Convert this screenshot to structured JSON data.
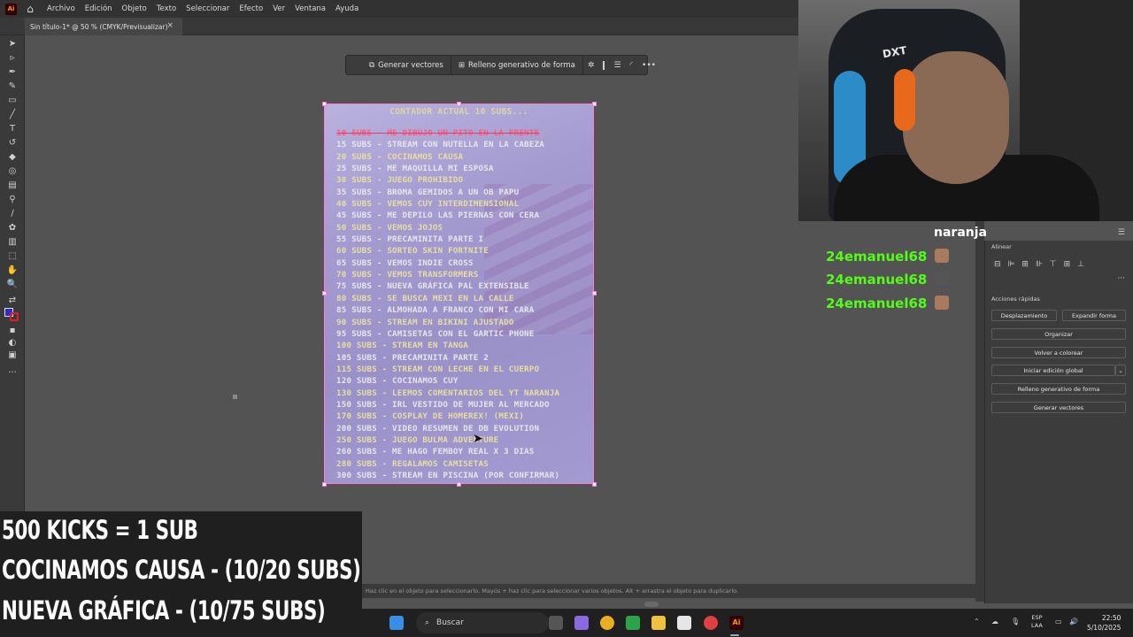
{
  "menubar": {
    "items": [
      "Archivo",
      "Edición",
      "Objeto",
      "Texto",
      "Seleccionar",
      "Efecto",
      "Ver",
      "Ventana",
      "Ayuda"
    ]
  },
  "doc_tab": {
    "label": "Sin título-1* @ 50 % (CMYK/Previsualizar)",
    "close": "×"
  },
  "context_bar": {
    "generate_vectors": "Generar vectores",
    "generative_fill": "Relleno generativo de forma",
    "more": "•••"
  },
  "artboard": {
    "title": "CONTADOR ACTUAL 10 SUBS...",
    "items": [
      {
        "text": "10 SUBS - ME DIBUJO UN PITO EN LA FRENTE",
        "color": "#ff5a7a",
        "done": true
      },
      {
        "text": "15 SUBS - STREAM CON NUTELLA EN LA CABEZA",
        "color": "#e6e6ec"
      },
      {
        "text": "20 SUBS - COCINAMOS CAUSA",
        "color": "#e6dfa0"
      },
      {
        "text": "25 SUBS - ME MAQUILLA MI ESPOSA",
        "color": "#e6e6ec"
      },
      {
        "text": "30 SUBS - JUEGO PROHIBIDO",
        "color": "#e6dfa0"
      },
      {
        "text": "35 SUBS - BROMA GEMIDOS A UN OB PAPU",
        "color": "#e6e6ec"
      },
      {
        "text": "40 SUBS - VEMOS CUY INTERDIMENSIONAL",
        "color": "#e6dfa0"
      },
      {
        "text": "45 SUBS - ME DEPILO LAS PIERNAS CON CERA",
        "color": "#e6e6ec"
      },
      {
        "text": "50 SUBS - VEMOS JOJOS",
        "color": "#e6dfa0"
      },
      {
        "text": "55 SUBS - PRECAMINITA PARTE I",
        "color": "#e6e6ec"
      },
      {
        "text": "60 SUBS - SORTEO SKIN FORTNITE",
        "color": "#e6dfa0"
      },
      {
        "text": "65 SUBS - VEMOS INDIE CROSS",
        "color": "#e6e6ec"
      },
      {
        "text": "70 SUBS - VEMOS TRANSFORMERS",
        "color": "#e6dfa0"
      },
      {
        "text": "75 SUBS - NUEVA GRÁFICA PAL EXTENSIBLE",
        "color": "#e6e6ec"
      },
      {
        "text": "80 SUBS - SE BUSCA MEXI EN LA CALLE",
        "color": "#e6dfa0"
      },
      {
        "text": "85 SUBS - ALMOHADA A FRANCO CON MI CARA",
        "color": "#e6e6ec"
      },
      {
        "text": "90 SUBS - STREAM EN BIKINI AJUSTADO",
        "color": "#e6dfa0"
      },
      {
        "text": "95 SUBS - CAMISETAS CON EL GARTIC PHONE",
        "color": "#e6e6ec"
      },
      {
        "text": "100 SUBS - STREAM EN TANGA",
        "color": "#e6dfa0"
      },
      {
        "text": "105 SUBS - PRECAMINITA PARTE 2",
        "color": "#e6e6ec"
      },
      {
        "text": "115 SUBS - STREAM CON LECHE EN EL CUERPO",
        "color": "#e6dfa0"
      },
      {
        "text": "120 SUBS - COCINAMOS CUY",
        "color": "#e6e6ec"
      },
      {
        "text": "130 SUBS - LEEMOS COMENTARIOS DEL YT NARANJA",
        "color": "#e6dfa0"
      },
      {
        "text": "150 SUBS - IRL VESTIDO DE MUJER AL MERCADO",
        "color": "#e6e6ec"
      },
      {
        "text": "170 SUBS - COSPLAY DE HOMEREX! (MEXI)",
        "color": "#e6dfa0"
      },
      {
        "text": "200 SUBS - VIDEO RESUMEN DE DB EVOLUTION",
        "color": "#e6e6ec"
      },
      {
        "text": "250 SUBS - JUEGO BULMA ADVENTURE",
        "color": "#e6dfa0"
      },
      {
        "text": "260 SUBS - ME HAGO FEMBOY REAL X 3 DIAS",
        "color": "#e6e6ec"
      },
      {
        "text": "280 SUBS - REGALAMOS CAMISETAS",
        "color": "#e6dfa0"
      },
      {
        "text": "300 SUBS - STREAM EN PISCINA (POR CONFIRMAR)",
        "color": "#e6e6ec"
      }
    ]
  },
  "overlay": {
    "line1": "500 KICKS = 1 SUB",
    "line2": "COCINAMOS CAUSA - (10/20 SUBS)",
    "line3": "NUEVA GRÁFICA - (10/75 SUBS)"
  },
  "statusbar": {
    "hint": "Haz clic en el objeto para seleccionarlo. Mayús + haz clic para seleccionar varios objetos. Alt + arrastra el objeto para duplicarlo."
  },
  "panel": {
    "align_title": "Alinear",
    "quick_actions_title": "Acciones rápidas",
    "offset": "Desplazamiento",
    "expand": "Expandir forma",
    "arrange": "Organizar",
    "recolor": "Volver a colorear",
    "global_edit": "Iniciar edición global",
    "generative_fill": "Relleno generativo de forma",
    "generate_vectors": "Generar vectores"
  },
  "chat": {
    "channel": "naranja",
    "messages": [
      "24emanuel68",
      "24emanuel68",
      "24emanuel68"
    ]
  },
  "taskbar": {
    "search": "Buscar",
    "lang_top": "ESP",
    "lang_bottom": "LAA",
    "time": "22:50",
    "date": "5/10/2025"
  },
  "webcam": {
    "chair_brand": "DXT"
  }
}
